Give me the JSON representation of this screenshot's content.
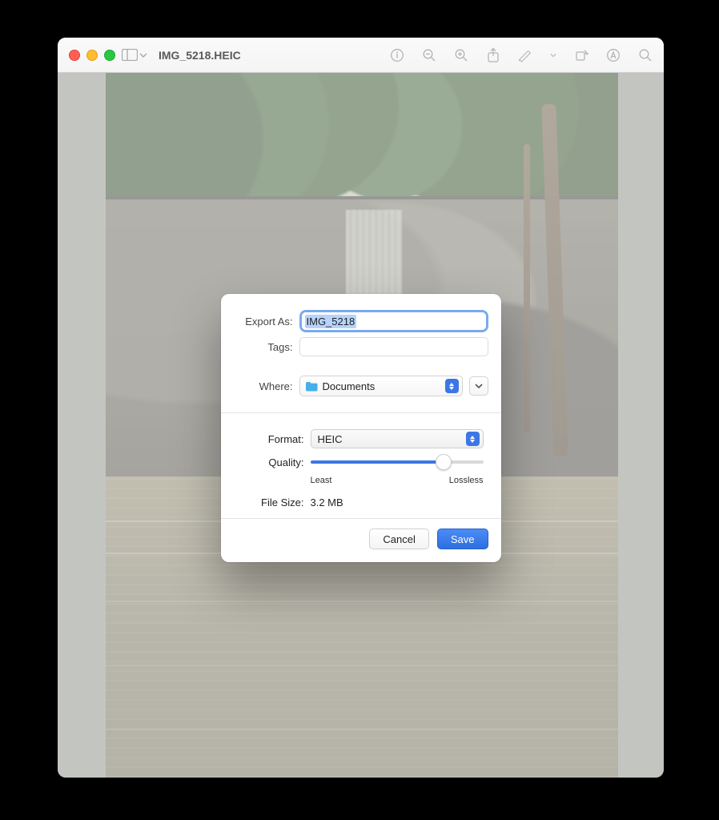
{
  "window": {
    "title": "IMG_5218.HEIC"
  },
  "toolbar": {
    "icons": [
      "sidebar",
      "chevron-down",
      "info",
      "zoom-out",
      "zoom-in",
      "share",
      "markup",
      "chevron-down-2",
      "rotate",
      "inspect",
      "search"
    ]
  },
  "dialog": {
    "exportAsLabel": "Export As:",
    "exportAsValue": "IMG_5218",
    "tagsLabel": "Tags:",
    "whereLabel": "Where:",
    "whereValue": "Documents",
    "formatLabel": "Format:",
    "formatValue": "HEIC",
    "qualityLabel": "Quality:",
    "qualityMinLabel": "Least",
    "qualityMaxLabel": "Lossless",
    "qualityPercent": 77,
    "fileSizeLabel": "File Size:",
    "fileSizeValue": "3.2 MB",
    "cancelLabel": "Cancel",
    "saveLabel": "Save"
  }
}
